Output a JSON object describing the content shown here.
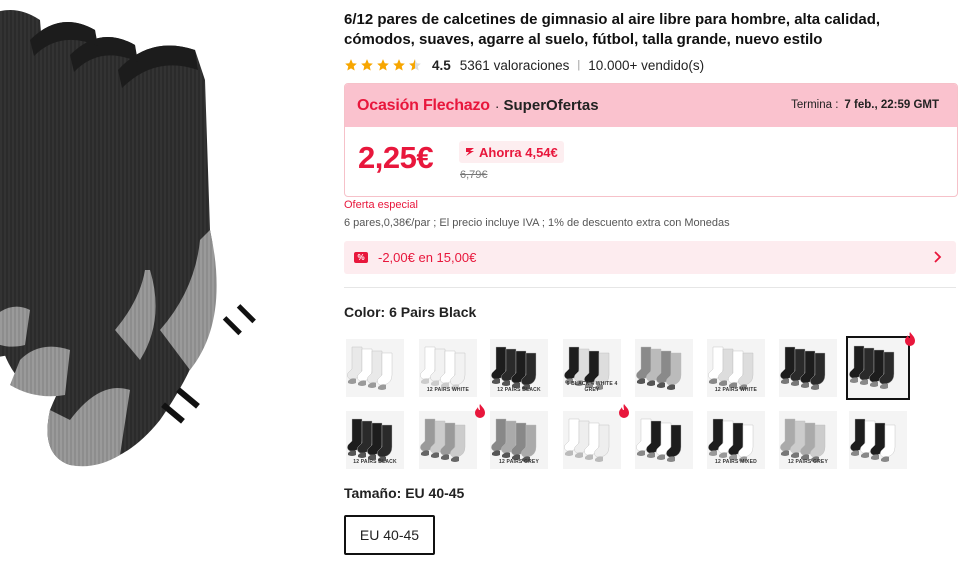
{
  "product": {
    "title": "6/12 pares de calcetines de gimnasio al aire libre para hombre, alta calidad, cómodos, suaves, agarre al suelo, fútbol, talla grande, nuevo estilo",
    "rating": 4.5,
    "score": "4.5",
    "reviews": "5361 valoraciones",
    "sold": "10.000+ vendido(s)"
  },
  "deal": {
    "brand": "Ocasión Flechazo",
    "dot": "·",
    "sub": "SuperOfertas",
    "ends_label": "Termina :",
    "ends_value": "7 feb., 22:59 GMT",
    "price": "2,25€",
    "save": "Ahorra 4,54€",
    "old_price": "6,79€",
    "colors": {
      "accent": "#e8173c",
      "banner": "#fac2ce",
      "soft": "#fdecef"
    }
  },
  "special_offer": "Oferta especial",
  "price_note": "6 pares,0,38€/par ; El precio incluye IVA ; 1% de descuento extra con Monedas",
  "coupon": {
    "icon": "percent-ticket-icon",
    "text": "-2,00€ en 15,00€"
  },
  "color": {
    "label": "Color: 6 Pairs Black",
    "swatches": [
      {
        "caption": "",
        "hot": false,
        "selected": false
      },
      {
        "caption": "12 PAIRS WHITE",
        "hot": false,
        "selected": false
      },
      {
        "caption": "12 PAIRS BLACK",
        "hot": false,
        "selected": false
      },
      {
        "caption": "6 BLACK 4 WHITE 4 GREY",
        "hot": false,
        "selected": false
      },
      {
        "caption": "",
        "hot": false,
        "selected": false
      },
      {
        "caption": "12 PAIRS WHITE",
        "hot": false,
        "selected": false
      },
      {
        "caption": "",
        "hot": false,
        "selected": false
      },
      {
        "caption": "",
        "hot": true,
        "selected": true
      },
      {
        "caption": "12 PAIRS BLACK",
        "hot": false,
        "selected": false
      },
      {
        "caption": "",
        "hot": true,
        "selected": false
      },
      {
        "caption": "12 PAIRS GREY",
        "hot": false,
        "selected": false
      },
      {
        "caption": "",
        "hot": true,
        "selected": false
      },
      {
        "caption": "",
        "hot": false,
        "selected": false
      },
      {
        "caption": "12 PAIRS MIXED",
        "hot": false,
        "selected": false
      },
      {
        "caption": "12 PAIRS GREY",
        "hot": false,
        "selected": false
      },
      {
        "caption": "",
        "hot": false,
        "selected": false
      }
    ]
  },
  "size": {
    "label": "Tamaño: EU 40-45",
    "option": "EU 40-45"
  }
}
